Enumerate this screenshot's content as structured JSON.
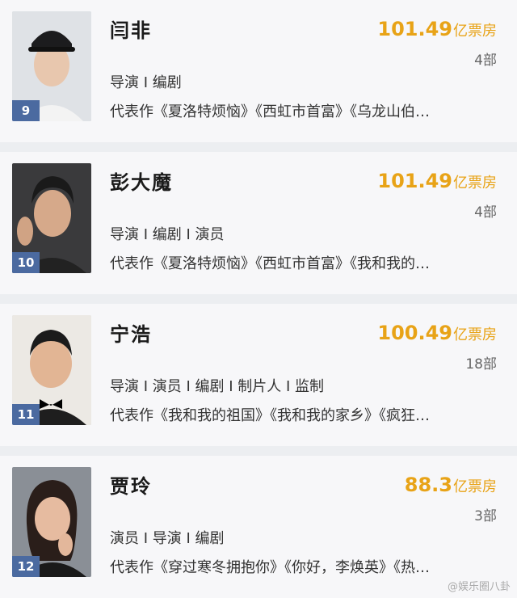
{
  "people": [
    {
      "rank": "9",
      "name": "闫非",
      "box_office": "101.49",
      "box_unit": "亿票房",
      "count": "4部",
      "roles": "导演 I 编剧",
      "works": "代表作《夏洛特烦恼》《西虹市首富》《乌龙山伯…"
    },
    {
      "rank": "10",
      "name": "彭大魔",
      "box_office": "101.49",
      "box_unit": "亿票房",
      "count": "4部",
      "roles": "导演 I 编剧 I 演员",
      "works": "代表作《夏洛特烦恼》《西虹市首富》《我和我的…"
    },
    {
      "rank": "11",
      "name": "宁浩",
      "box_office": "100.49",
      "box_unit": "亿票房",
      "count": "18部",
      "roles": "导演 I 演员 I 编剧 I 制片人 I 监制",
      "works": "代表作《我和我的祖国》《我和我的家乡》《疯狂…"
    },
    {
      "rank": "12",
      "name": "贾玲",
      "box_office": "88.3",
      "box_unit": "亿票房",
      "count": "3部",
      "roles": "演员 I 导演 I 编剧",
      "works": "代表作《穿过寒冬拥抱你》《你好，李焕英》《热…"
    }
  ],
  "watermark": "@娱乐圈八卦",
  "colors": {
    "accent": "#e8a317",
    "rank_badge": "#4b6aa0",
    "background": "#f7f7f9"
  }
}
